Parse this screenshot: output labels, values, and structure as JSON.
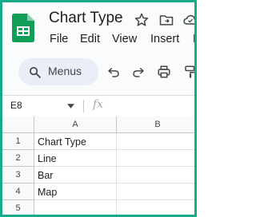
{
  "app": {
    "title": "Chart Type",
    "logo_icon": "google-sheets-logo",
    "title_icons": [
      "star-icon",
      "move-to-folder-icon",
      "cloud-status-icon"
    ]
  },
  "menu": {
    "items": [
      "File",
      "Edit",
      "View",
      "Insert",
      "F"
    ]
  },
  "toolbar": {
    "search_label": "Menus",
    "icons": [
      "undo-icon",
      "redo-icon",
      "print-icon",
      "paint-format-icon"
    ]
  },
  "formula_bar": {
    "cell_ref": "E8",
    "fx_label": "fx",
    "value": ""
  },
  "grid": {
    "columns": [
      "A",
      "B"
    ],
    "rows": [
      {
        "num": "1",
        "A": "Chart Type",
        "B": ""
      },
      {
        "num": "2",
        "A": "Line",
        "B": ""
      },
      {
        "num": "3",
        "A": "Bar",
        "B": ""
      },
      {
        "num": "4",
        "A": "Map",
        "B": ""
      },
      {
        "num": "5",
        "A": "",
        "B": ""
      }
    ]
  },
  "colors": {
    "frame_border": "#19a98b",
    "sheets_green": "#0f9d58",
    "chrome_bg": "#f9fbfd",
    "search_bg": "#e9eef6"
  }
}
